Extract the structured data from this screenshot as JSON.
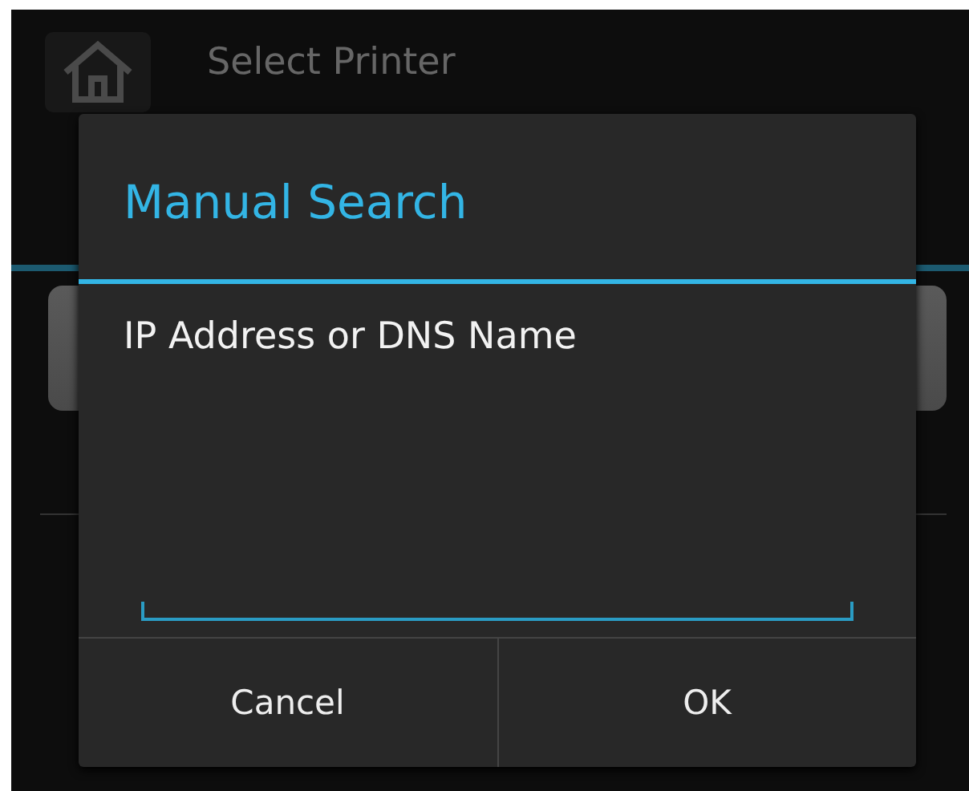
{
  "app_bar": {
    "title": "Select Printer"
  },
  "dialog": {
    "title": "Manual Search",
    "field_label": "IP Address or DNS Name",
    "buttons": [
      {
        "label": "Cancel"
      },
      {
        "label": "OK"
      }
    ]
  }
}
